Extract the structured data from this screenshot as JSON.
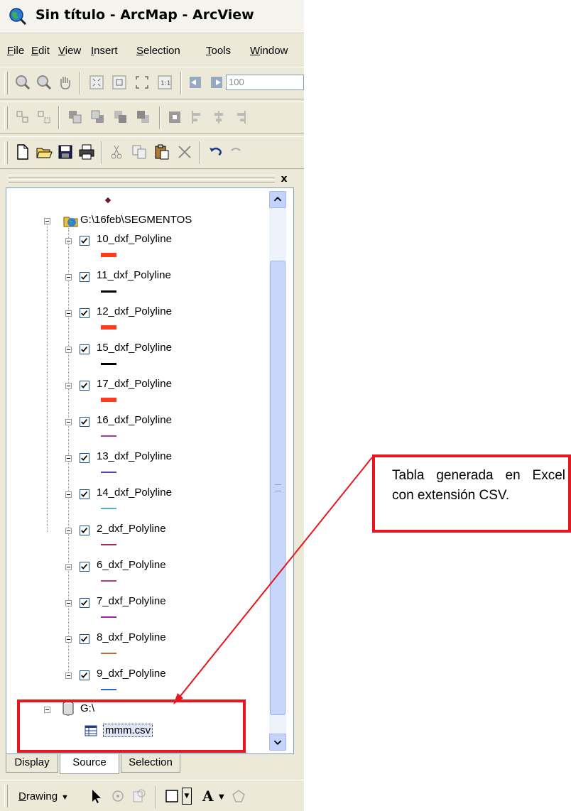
{
  "window": {
    "title": "Sin título - ArcMap - ArcView"
  },
  "menu": {
    "file": {
      "u": "F",
      "rest": "ile"
    },
    "edit": {
      "u": "E",
      "rest": "dit"
    },
    "view": {
      "u": "V",
      "rest": "iew"
    },
    "insert": {
      "u": "I",
      "rest": "nsert"
    },
    "selection": {
      "u": "S",
      "rest": "election"
    },
    "tools": {
      "u": "T",
      "rest": "ools"
    },
    "window": {
      "u": "W",
      "rest": "indow"
    }
  },
  "toolbar": {
    "zoom_value": "100"
  },
  "toc": {
    "close_label": "x",
    "root_path": "G:\\16feb\\SEGMENTOS",
    "layers": [
      {
        "name": "10_dxf_Polyline",
        "checked": true,
        "color": "#ff3b1f",
        "weight": "thick"
      },
      {
        "name": "11_dxf_Polyline",
        "checked": true,
        "color": "#000000",
        "weight": "medium"
      },
      {
        "name": "12_dxf_Polyline",
        "checked": true,
        "color": "#ff3b1f",
        "weight": "thick"
      },
      {
        "name": "15_dxf_Polyline",
        "checked": true,
        "color": "#000000",
        "weight": "medium"
      },
      {
        "name": "17_dxf_Polyline",
        "checked": true,
        "color": "#ff3b1f",
        "weight": "thick"
      },
      {
        "name": "16_dxf_Polyline",
        "checked": true,
        "color": "#a23ca0",
        "weight": "thin"
      },
      {
        "name": "13_dxf_Polyline",
        "checked": true,
        "color": "#5a3cb4",
        "weight": "thin"
      },
      {
        "name": "14_dxf_Polyline",
        "checked": true,
        "color": "#4bb4d2",
        "weight": "thin"
      },
      {
        "name": "2_dxf_Polyline",
        "checked": true,
        "color": "#a0285a",
        "weight": "thin"
      },
      {
        "name": "6_dxf_Polyline",
        "checked": true,
        "color": "#b43c78",
        "weight": "thin"
      },
      {
        "name": "7_dxf_Polyline",
        "checked": true,
        "color": "#9628a0",
        "weight": "thin"
      },
      {
        "name": "8_dxf_Polyline",
        "checked": true,
        "color": "#b46e3c",
        "weight": "thin"
      },
      {
        "name": "9_dxf_Polyline",
        "checked": true,
        "color": "#2864dc",
        "weight": "thin"
      }
    ],
    "workspace_path": "G:\\",
    "table_name": "mmm.csv"
  },
  "tabs": {
    "display": "Display",
    "source": "Source",
    "selection": "Selection"
  },
  "drawing": {
    "u": "D",
    "rest": "rawing"
  },
  "annotation": {
    "text": "Tabla generada en Excel con extensión CSV."
  },
  "colors": {
    "highlight": "#e8161d",
    "panel_border": "#7f9db9",
    "chrome": "#ece9d8"
  }
}
